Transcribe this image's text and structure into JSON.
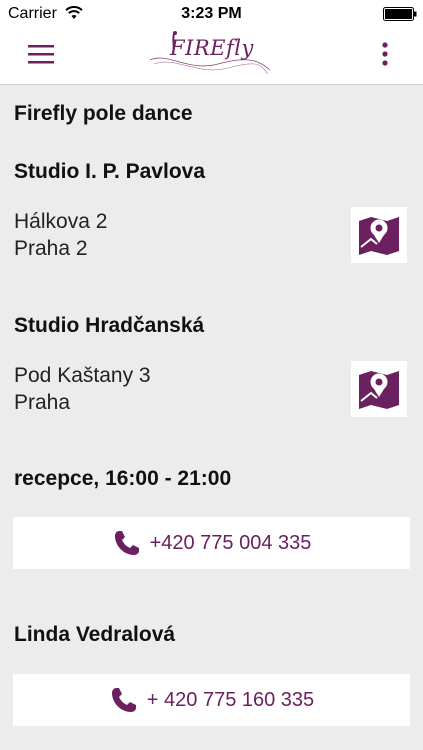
{
  "status_bar": {
    "carrier": "Carrier",
    "time": "3:23 PM"
  },
  "header": {
    "logo_text": "FIREfly",
    "accent_color": "#6b2160"
  },
  "page": {
    "title": "Firefly pole dance"
  },
  "studios": [
    {
      "name": "Studio I. P. Pavlova",
      "address_line1": "Hálkova 2",
      "address_line2": "Praha 2"
    },
    {
      "name": "Studio Hradčanská",
      "address_line1": "Pod Kaštany 3",
      "address_line2": "Praha"
    }
  ],
  "contacts": [
    {
      "label": "recepce, 16:00 - 21:00",
      "phone": "+420 775 004 335"
    },
    {
      "label": "Linda Vedralová",
      "phone": "+ 420 775 160 335"
    }
  ],
  "icons": {
    "menu": "hamburger-menu-icon",
    "more": "more-vertical-icon",
    "map": "map-pin-icon",
    "phone": "phone-icon"
  }
}
